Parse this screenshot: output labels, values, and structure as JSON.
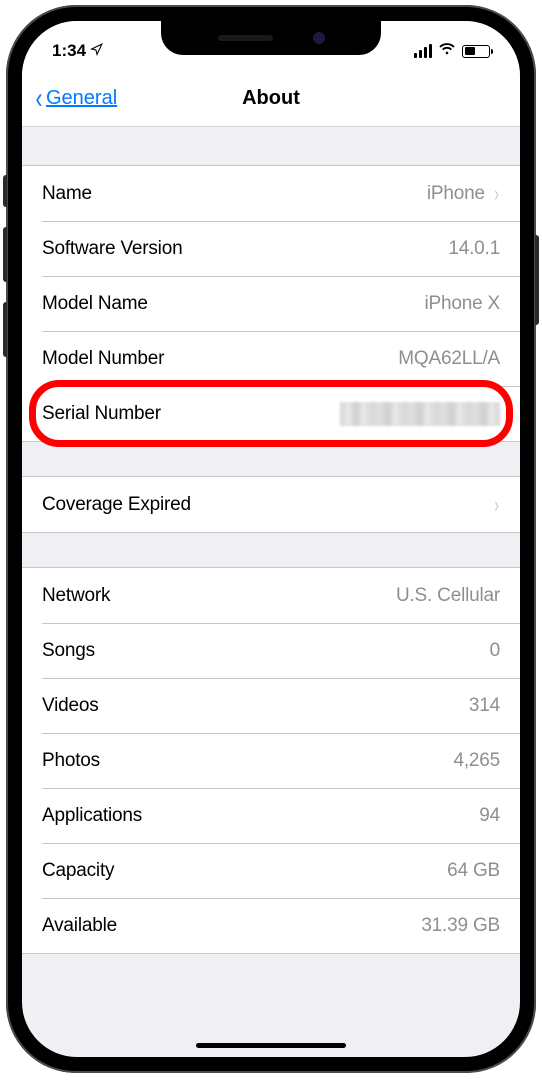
{
  "status_bar": {
    "time": "1:34"
  },
  "nav": {
    "back_label": "General",
    "title": "About"
  },
  "section1": {
    "name_label": "Name",
    "name_value": "iPhone",
    "software_label": "Software Version",
    "software_value": "14.0.1",
    "model_name_label": "Model Name",
    "model_name_value": "iPhone X",
    "model_number_label": "Model Number",
    "model_number_value": "MQA62LL/A",
    "serial_label": "Serial Number"
  },
  "section2": {
    "coverage_label": "Coverage Expired"
  },
  "section3": {
    "network_label": "Network",
    "network_value": "U.S. Cellular",
    "songs_label": "Songs",
    "songs_value": "0",
    "videos_label": "Videos",
    "videos_value": "314",
    "photos_label": "Photos",
    "photos_value": "4,265",
    "apps_label": "Applications",
    "apps_value": "94",
    "capacity_label": "Capacity",
    "capacity_value": "64 GB",
    "available_label": "Available",
    "available_value": "31.39 GB"
  }
}
